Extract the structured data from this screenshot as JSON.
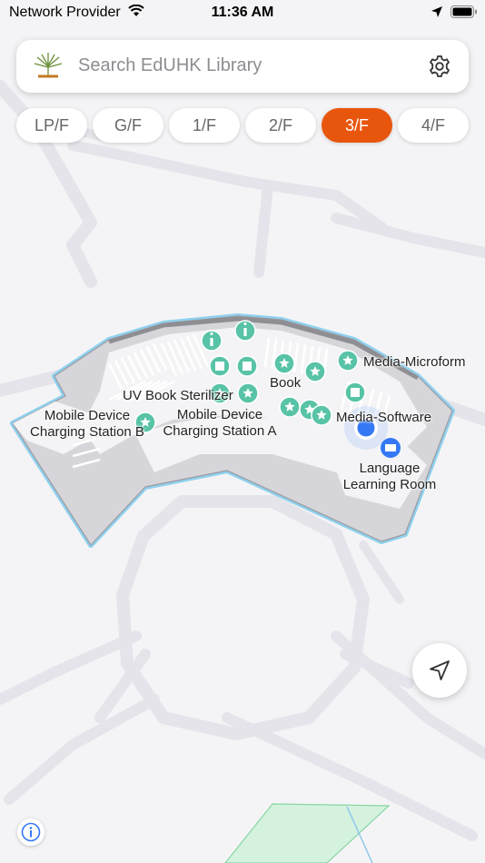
{
  "status_bar": {
    "carrier": "Network Provider",
    "time": "11:36 AM"
  },
  "search": {
    "placeholder": "Search EdUHK Library"
  },
  "floors": {
    "items": [
      {
        "label": "LP/F"
      },
      {
        "label": "G/F"
      },
      {
        "label": "1/F"
      },
      {
        "label": "2/F"
      },
      {
        "label": "3/F",
        "active": true
      },
      {
        "label": "4/F"
      }
    ]
  },
  "map_labels": {
    "media_microform": "Media-Microform",
    "uv_book_sterilizer": "UV Book Sterilizer",
    "book": "Book",
    "media_software": "Media-Software",
    "charging_b_line1": "Mobile Device",
    "charging_b_line2": "Charging Station B",
    "charging_a_line1": "Mobile Device",
    "charging_a_line2": "Charging Station A",
    "language_line1": "Language",
    "language_line2": "Learning Room"
  },
  "colors": {
    "accent": "#e8560e",
    "poi": "#58c3a6",
    "user_location": "#3478f6",
    "floor_outline": "#8fd0ee"
  },
  "icons": {
    "search_logo": "library-logo-icon",
    "settings": "gear-icon",
    "locate": "navigation-arrow-icon",
    "info": "info-icon"
  }
}
